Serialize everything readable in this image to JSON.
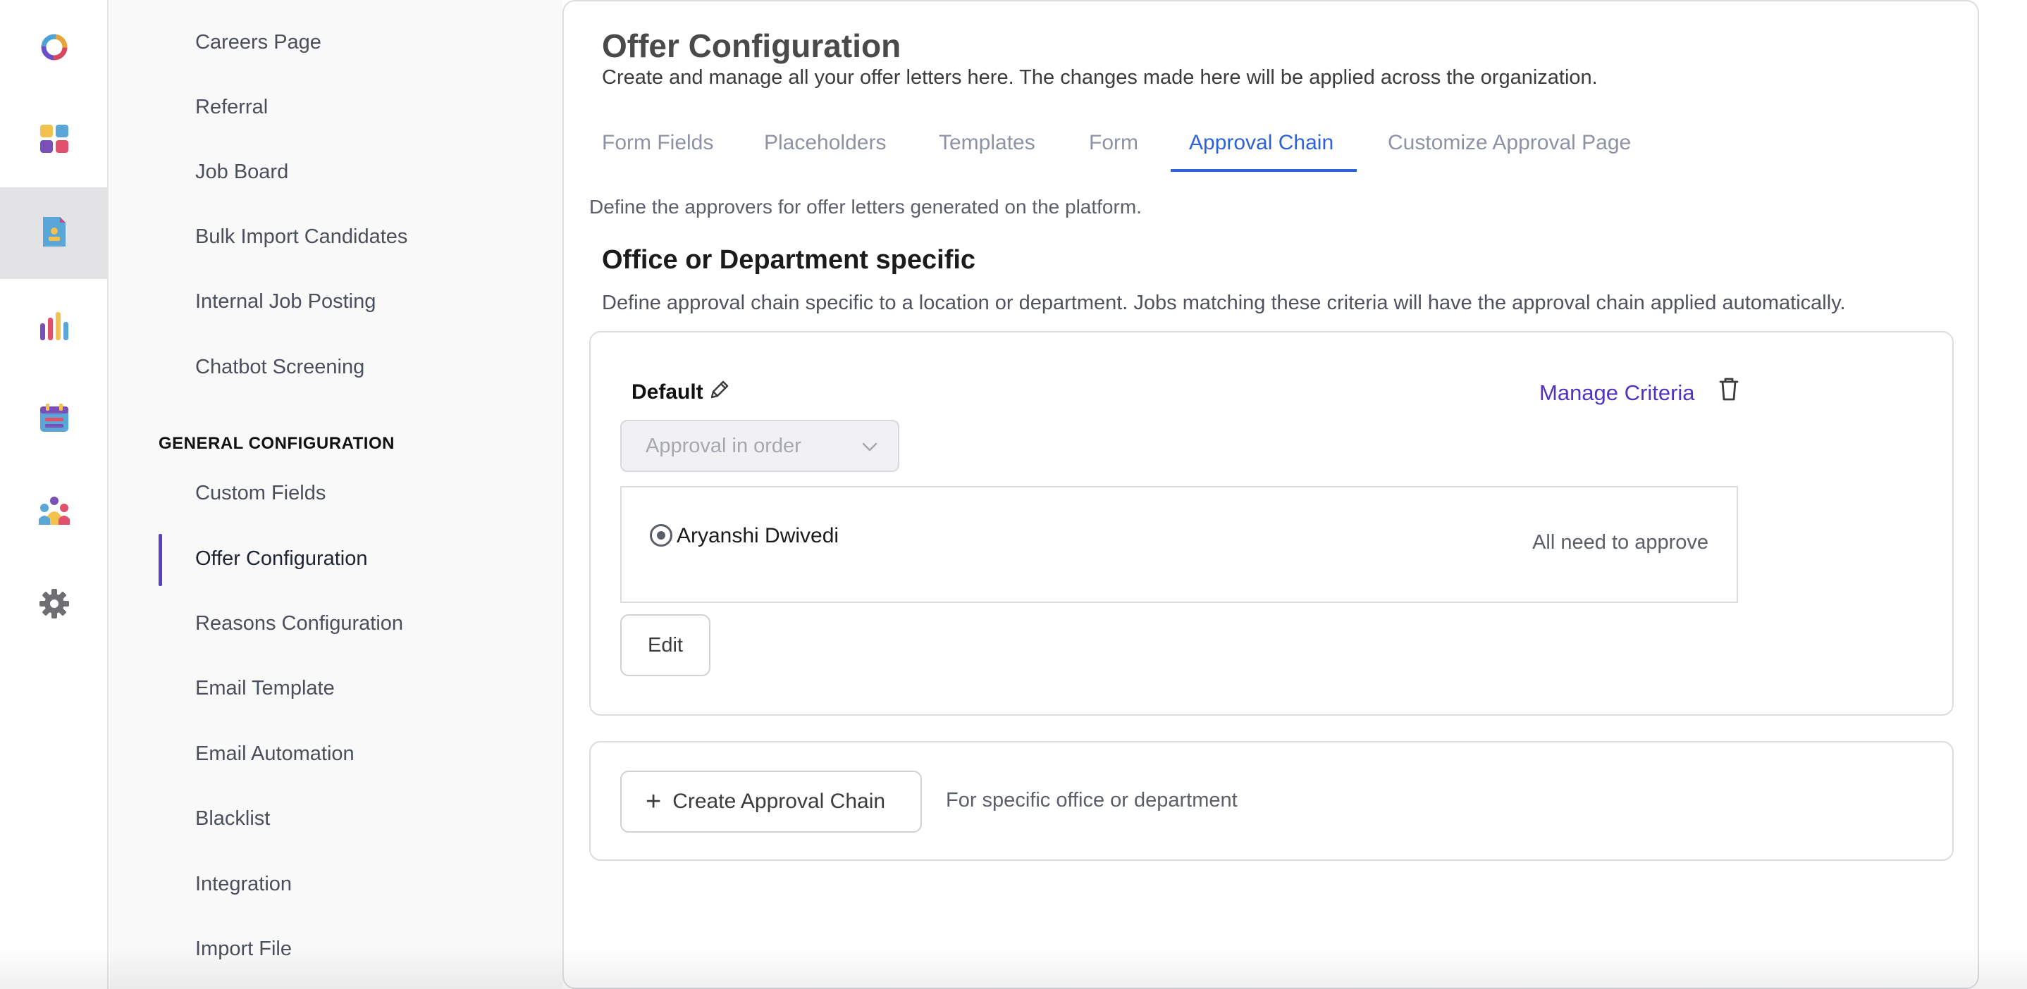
{
  "rail": {
    "items": [
      {
        "icon": "app-logo-icon"
      },
      {
        "icon": "dashboard-grid-icon"
      },
      {
        "icon": "candidate-document-icon",
        "active": true
      },
      {
        "icon": "analytics-bar-chart-icon"
      },
      {
        "icon": "calendar-icon"
      },
      {
        "icon": "team-people-icon"
      },
      {
        "icon": "gear-icon"
      }
    ]
  },
  "sidebar": {
    "items_top": [
      {
        "label": "Careers Page"
      },
      {
        "label": "Referral"
      },
      {
        "label": "Job Board"
      },
      {
        "label": "Bulk Import Candidates"
      },
      {
        "label": "Internal Job Posting"
      },
      {
        "label": "Chatbot Screening"
      }
    ],
    "section_label": "GENERAL CONFIGURATION",
    "items_general": [
      {
        "label": "Custom Fields"
      },
      {
        "label": "Offer Configuration",
        "active": true
      },
      {
        "label": "Reasons Configuration"
      },
      {
        "label": "Email Template"
      },
      {
        "label": "Email Automation"
      },
      {
        "label": "Blacklist"
      },
      {
        "label": "Integration"
      },
      {
        "label": "Import File"
      }
    ]
  },
  "main": {
    "title": "Offer Configuration",
    "subtitle": "Create and manage all your offer letters here. The changes made here will be applied across the organization.",
    "tabs": [
      {
        "label": "Form Fields"
      },
      {
        "label": "Placeholders"
      },
      {
        "label": "Templates"
      },
      {
        "label": "Form"
      },
      {
        "label": "Approval Chain",
        "active": true
      },
      {
        "label": "Customize Approval Page"
      }
    ],
    "define_text": "Define the approvers for offer letters generated on the platform.",
    "section_title": "Office or Department specific",
    "section_sub": "Define approval chain specific to a location or department. Jobs matching these criteria will have the approval chain applied automatically.",
    "chain": {
      "name": "Default",
      "manage_criteria": "Manage Criteria",
      "approval_mode": "Approval in order",
      "approvers": [
        {
          "name": "Aryanshi Dwivedi",
          "rule": "All need to approve"
        }
      ],
      "edit_label": "Edit"
    },
    "create": {
      "button_label": "Create Approval Chain",
      "hint": "For specific office or department"
    }
  },
  "colors": {
    "accent_tab": "#2d63d6",
    "accent_link": "#5233c0",
    "sidebar_indicator": "#5a3fc4"
  }
}
